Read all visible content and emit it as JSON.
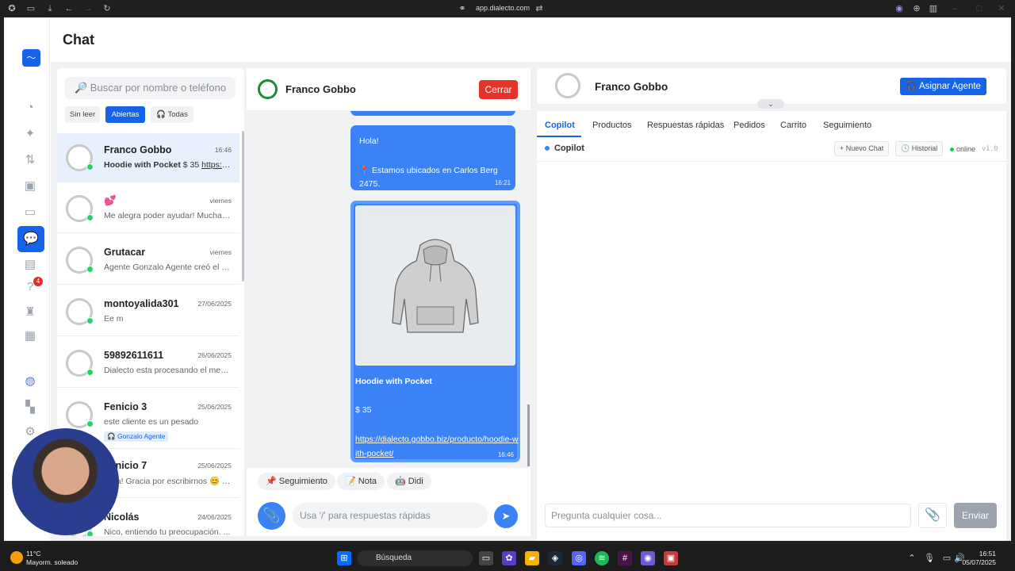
{
  "browser": {
    "url": "app.dialecto.com"
  },
  "page": {
    "title": "Chat"
  },
  "nav": {
    "badge_count": "4"
  },
  "search": {
    "placeholder": "🔎 Buscar por nombre o teléfono"
  },
  "filters": [
    "Sin leer",
    "Abiertas",
    "Todas"
  ],
  "conversations": [
    {
      "name": "Franco Gobbo",
      "date": "16:46",
      "preview": "Hoodie with Pocket $ 35 https://...",
      "selected": true
    },
    {
      "name": "💕",
      "date": "viernes",
      "preview": "Me alegra poder ayudar! Mucha ..."
    },
    {
      "name": "Grutacar",
      "date": "viernes",
      "preview": "Agente Gonzalo Agente creó el ti..."
    },
    {
      "name": "montoyalida301",
      "date": "27/06/2025",
      "preview": "Ee m"
    },
    {
      "name": "59892611611",
      "date": "26/06/2025",
      "preview": "Dialecto esta procesando el men..."
    },
    {
      "name": "Fenicio 3",
      "date": "25/06/2025",
      "preview": "este cliente es un pesado",
      "tag": "🎧 Gonzalo Agente"
    },
    {
      "name": "Fenicio 7",
      "date": "25/06/2025",
      "preview": "Hola! Gracia por escribirnos 😊 U..."
    },
    {
      "name": "Nicolás",
      "date": "24/06/2025",
      "preview": "Nico, entiendo tu preocupación. ..."
    }
  ],
  "chat": {
    "contact": "Franco Gobbo",
    "close_label": "Cerrar",
    "messages": [
      {
        "text1": "Hola!",
        "text2": "📍 Estamos ubicados en Carlos Berg 2475.",
        "time": "16:21"
      },
      {
        "product": "Hoodie with Pocket",
        "price": "$ 35",
        "link": "https://dialecto.gobbo.biz/producto/hoodie-with-pocket/",
        "time": "16:46"
      }
    ],
    "quick_actions": [
      "📌 Seguimiento",
      "📝 Nota",
      "🤖 Didi"
    ],
    "input_placeholder": "Usa '/' para respuestas rápidas"
  },
  "customer": {
    "name": "Franco Gobbo",
    "assign_label": "Asignar Agente"
  },
  "tabs": [
    "Copilot",
    "Productos",
    "Respuestas rápidas",
    "Pedidos",
    "Carrito",
    "Seguimiento"
  ],
  "copilot": {
    "label": "Copilot",
    "new_chat": "+ Nuevo Chat",
    "history": "🕓 Historial",
    "status": "online",
    "version": "v1.0",
    "ask_placeholder": "Pregunta cualquier cosa...",
    "send_label": "Enviar"
  },
  "taskbar": {
    "weather_temp": "11°C",
    "weather_desc": "Mayorm. soleado",
    "search_label": "Búsqueda",
    "time": "16:51",
    "date": "05/07/2025"
  }
}
